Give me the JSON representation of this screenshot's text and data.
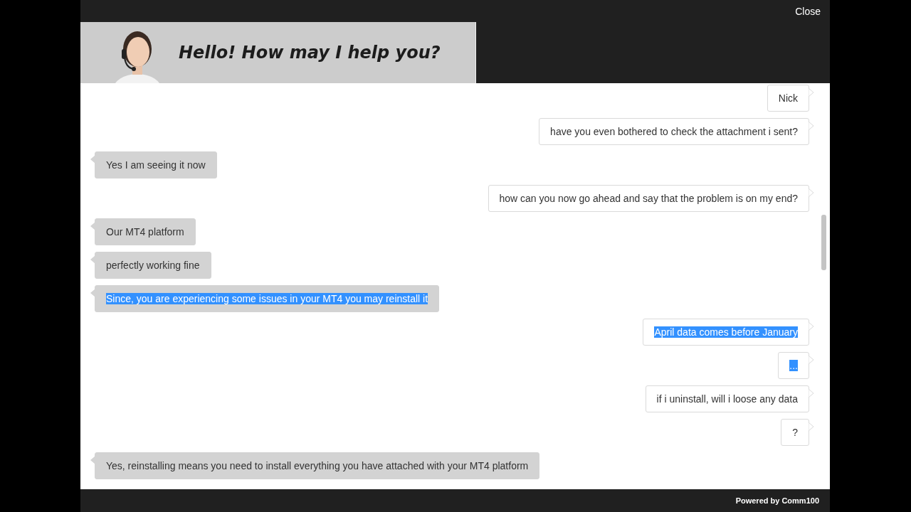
{
  "window": {
    "close": "Close"
  },
  "banner": {
    "greeting": "Hello! How may I help you?"
  },
  "messages": [
    {
      "kind": "visitor",
      "text": "Nick",
      "selected": false
    },
    {
      "kind": "visitor",
      "text": "have you even bothered to check the attachment i sent?",
      "selected": false
    },
    {
      "kind": "agent",
      "text": "Yes I am seeing it now",
      "selected": false
    },
    {
      "kind": "visitor",
      "text": "how can you now go ahead and say that the problem is on my end?",
      "selected": false
    },
    {
      "kind": "agent",
      "text": "Our MT4 platform",
      "selected": false
    },
    {
      "kind": "agent",
      "text": "perfectly working fine",
      "selected": false
    },
    {
      "kind": "agent",
      "text": "Since, you are experiencing some issues in your MT4 you may reinstall it",
      "selected": true
    },
    {
      "kind": "visitor",
      "text": "April data comes before January",
      "selected": true
    },
    {
      "kind": "visitor",
      "text": "...",
      "selected": true
    },
    {
      "kind": "visitor",
      "text": "if i uninstall, will i loose any data",
      "selected": false
    },
    {
      "kind": "visitor",
      "text": "?",
      "selected": false
    },
    {
      "kind": "agent",
      "text": "Yes, reinstalling means you need to install everything you have attached with your MT4 platform",
      "selected": false
    }
  ],
  "footer": {
    "powered_by": "Powered by Comm100"
  }
}
